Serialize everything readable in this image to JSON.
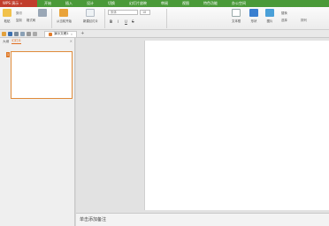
{
  "app": {
    "logo": "WPS 演示",
    "menu": [
      "开始",
      "插入",
      "设计",
      "切换",
      "幻灯片放映",
      "审阅",
      "视图",
      "特色功能",
      "办公空间"
    ]
  },
  "ribbon": {
    "paste": "粘贴",
    "cut": "剪切",
    "copy": "复制",
    "format_painter": "格式刷",
    "from_current": "从当前开始",
    "new_slide": "新建幻灯片",
    "font_name": "宋体",
    "font_size": "18",
    "bold": "B",
    "italic": "I",
    "underline": "U",
    "strike": "S",
    "textbox": "文本框",
    "shape": "形状",
    "picture": "图片",
    "replace": "替换",
    "select": "选择",
    "arrange": "排列"
  },
  "tabbar": {
    "doc_title": "演示文稿1",
    "plus": "+"
  },
  "panel": {
    "tab_outline": "大纲",
    "tab_slides": "幻灯片",
    "slide_number": "1"
  },
  "notes": {
    "placeholder": "单击添加备注"
  },
  "colors": {
    "title_green": "#4a9a39",
    "logo_red": "#c13d2c",
    "accent_orange": "#e07b2a"
  }
}
